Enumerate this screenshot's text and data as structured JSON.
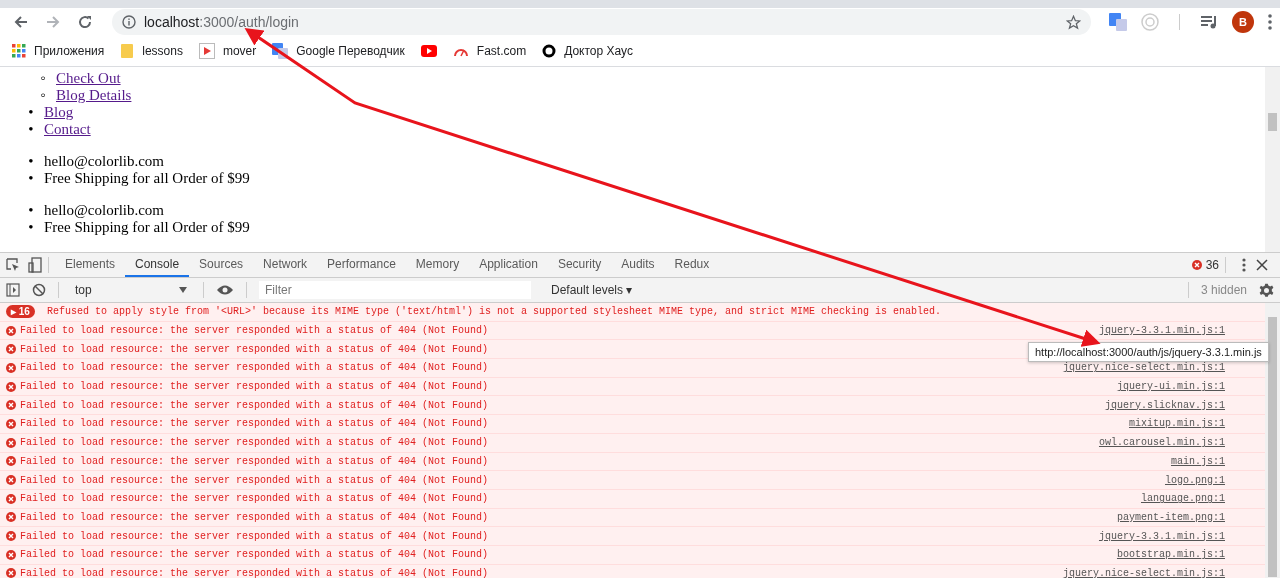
{
  "toolbar": {
    "back_disabled": false,
    "forward_disabled": true,
    "url_host": "localhost",
    "url_path": ":3000/auth/login",
    "profile": "B"
  },
  "bookmarks": [
    {
      "kind": "apps",
      "label": "Приложения"
    },
    {
      "kind": "folder",
      "label": "lessons"
    },
    {
      "kind": "play",
      "label": "mover"
    },
    {
      "kind": "translate",
      "label": "Google Переводчик"
    },
    {
      "kind": "video"
    },
    {
      "kind": "gauge",
      "label": "Fast.com"
    },
    {
      "kind": "ring",
      "label": "Доктор Хаус"
    }
  ],
  "page": {
    "sub_links": [
      {
        "marker": "◦",
        "text": "Check Out"
      },
      {
        "marker": "◦",
        "text": "Blog Details"
      }
    ],
    "links": [
      {
        "marker": "•",
        "text": "Blog"
      },
      {
        "marker": "•",
        "text": "Contact"
      }
    ],
    "info_lists": [
      [
        {
          "marker": "•",
          "text": "hello@colorlib.com"
        },
        {
          "marker": "•",
          "text": "Free Shipping for all Order of $99"
        }
      ],
      [
        {
          "marker": "•",
          "text": "hello@colorlib.com"
        },
        {
          "marker": "•",
          "text": "Free Shipping for all Order of $99"
        }
      ]
    ]
  },
  "devtools": {
    "tabs": [
      {
        "label": "Elements",
        "selected": false
      },
      {
        "label": "Console",
        "selected": true
      },
      {
        "label": "Sources",
        "selected": false
      },
      {
        "label": "Network",
        "selected": false
      },
      {
        "label": "Performance",
        "selected": false
      },
      {
        "label": "Memory",
        "selected": false
      },
      {
        "label": "Application",
        "selected": false
      },
      {
        "label": "Security",
        "selected": false
      },
      {
        "label": "Audits",
        "selected": false
      },
      {
        "label": "Redux",
        "selected": false
      }
    ],
    "error_count": "36",
    "context": "top",
    "filter_placeholder": "Filter",
    "levels": "Default levels ▾",
    "hidden": "3 hidden"
  },
  "messages": [
    {
      "kind": "group",
      "marker": "▸",
      "count": "16",
      "text": "Refused to apply style from '<URL>' because its MIME type ('text/html') is not a supported stylesheet MIME type, and strict MIME checking is enabled."
    },
    {
      "kind": "error",
      "text": "Failed to load resource: the server responded with a status of 404 (Not Found)",
      "source": "jquery-3.3.1.min.js:1"
    },
    {
      "kind": "error",
      "text": "Failed to load resource: the server responded with a status of 404 (Not Found)"
    },
    {
      "kind": "error",
      "text": "Failed to load resource: the server responded with a status of 404 (Not Found)",
      "source": "jquery.nice-select.min.js:1"
    },
    {
      "kind": "error",
      "text": "Failed to load resource: the server responded with a status of 404 (Not Found)",
      "source": "jquery-ui.min.js:1"
    },
    {
      "kind": "error",
      "text": "Failed to load resource: the server responded with a status of 404 (Not Found)",
      "source": "jquery.slicknav.js:1"
    },
    {
      "kind": "error",
      "text": "Failed to load resource: the server responded with a status of 404 (Not Found)",
      "source": "mixitup.min.js:1"
    },
    {
      "kind": "error",
      "text": "Failed to load resource: the server responded with a status of 404 (Not Found)",
      "source": "owl.carousel.min.js:1"
    },
    {
      "kind": "error",
      "text": "Failed to load resource: the server responded with a status of 404 (Not Found)",
      "source": "main.js:1"
    },
    {
      "kind": "error",
      "text": "Failed to load resource: the server responded with a status of 404 (Not Found)",
      "source": "logo.png:1"
    },
    {
      "kind": "error",
      "text": "Failed to load resource: the server responded with a status of 404 (Not Found)",
      "source": "language.png:1"
    },
    {
      "kind": "error",
      "text": "Failed to load resource: the server responded with a status of 404 (Not Found)",
      "source": "payment-item.png:1"
    },
    {
      "kind": "error",
      "text": "Failed to load resource: the server responded with a status of 404 (Not Found)",
      "source": "jquery-3.3.1.min.js:1"
    },
    {
      "kind": "error",
      "text": "Failed to load resource: the server responded with a status of 404 (Not Found)",
      "source": "bootstrap.min.js:1"
    },
    {
      "kind": "error",
      "text": "Failed to load resource: the server responded with a status of 404 (Not Found)",
      "source": "jquery.nice-select.min.js:1"
    }
  ],
  "tooltip": "http://localhost:3000/auth/js/jquery-3.3.1.min.js"
}
